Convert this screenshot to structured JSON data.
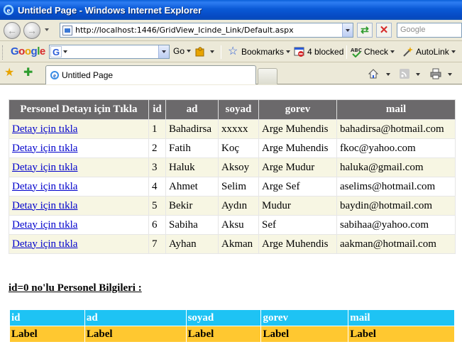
{
  "window": {
    "title": "Untitled Page - Windows Internet Explorer"
  },
  "address_bar": {
    "url": "http://localhost:1446/GridView_Icinde_Link/Default.aspx"
  },
  "search_box": {
    "placeholder": "Google"
  },
  "google_toolbar": {
    "logo": [
      "G",
      "o",
      "o",
      "g",
      "l",
      "e"
    ],
    "search_badge": "G",
    "go_label": "Go",
    "bookmarks_label": "Bookmarks",
    "blocked_label": "4 blocked",
    "check_label": "Check",
    "autolink_label": "AutoLink"
  },
  "tab": {
    "label": "Untitled Page"
  },
  "icons": {
    "back": "back-arrow-icon",
    "forward": "forward-arrow-icon",
    "refresh": "refresh-icon",
    "stop": "stop-icon",
    "favorites": "star-icon",
    "add_favorite": "add-favorite-icon",
    "home": "home-icon",
    "feeds": "rss-feed-icon",
    "print": "printer-icon"
  },
  "grid": {
    "columns": [
      "Personel Detayı için Tıkla",
      "id",
      "ad",
      "soyad",
      "gorev",
      "mail"
    ],
    "rows": [
      {
        "link": "Detay için tıkla",
        "id": "1",
        "ad": "Bahadirsa",
        "soyad": "xxxxx",
        "gorev": "Arge Muhendis",
        "mail": "bahadirsa@hotmail.com"
      },
      {
        "link": "Detay için tıkla",
        "id": "2",
        "ad": "Fatih",
        "soyad": "Koç",
        "gorev": "Arge Muhendis",
        "mail": "fkoc@yahoo.com"
      },
      {
        "link": "Detay için tıkla",
        "id": "3",
        "ad": "Haluk",
        "soyad": "Aksoy",
        "gorev": "Arge Mudur",
        "mail": "haluka@gmail.com"
      },
      {
        "link": "Detay için tıkla",
        "id": "4",
        "ad": "Ahmet",
        "soyad": "Selim",
        "gorev": "Arge Sef",
        "mail": "aselims@hotmail.com"
      },
      {
        "link": "Detay için tıkla",
        "id": "5",
        "ad": "Bekir",
        "soyad": "Aydın",
        "gorev": "Mudur",
        "mail": "baydin@hotmail.com"
      },
      {
        "link": "Detay için tıkla",
        "id": "6",
        "ad": "Sabiha",
        "soyad": "Aksu",
        "gorev": "Sef",
        "mail": "sabihaa@yahoo.com"
      },
      {
        "link": "Detay için tıkla",
        "id": "7",
        "ad": "Ayhan",
        "soyad": "Akman",
        "gorev": "Arge Muhendis",
        "mail": "aakman@hotmail.com"
      }
    ],
    "colors": {
      "header_bg": "#6b696b",
      "odd_row_bg": "#f7f6e3",
      "even_row_bg": "#ffffff",
      "link": "#0000cc"
    }
  },
  "detail": {
    "title": "id=0 no'lu Personel Bilgileri :",
    "columns": [
      "id",
      "ad",
      "soyad",
      "gorev",
      "mail"
    ],
    "values": [
      "Label",
      "Label",
      "Label",
      "Label",
      "Label"
    ],
    "colors": {
      "header_bg": "#1ec3f4",
      "value_bg": "#ffc830"
    }
  }
}
